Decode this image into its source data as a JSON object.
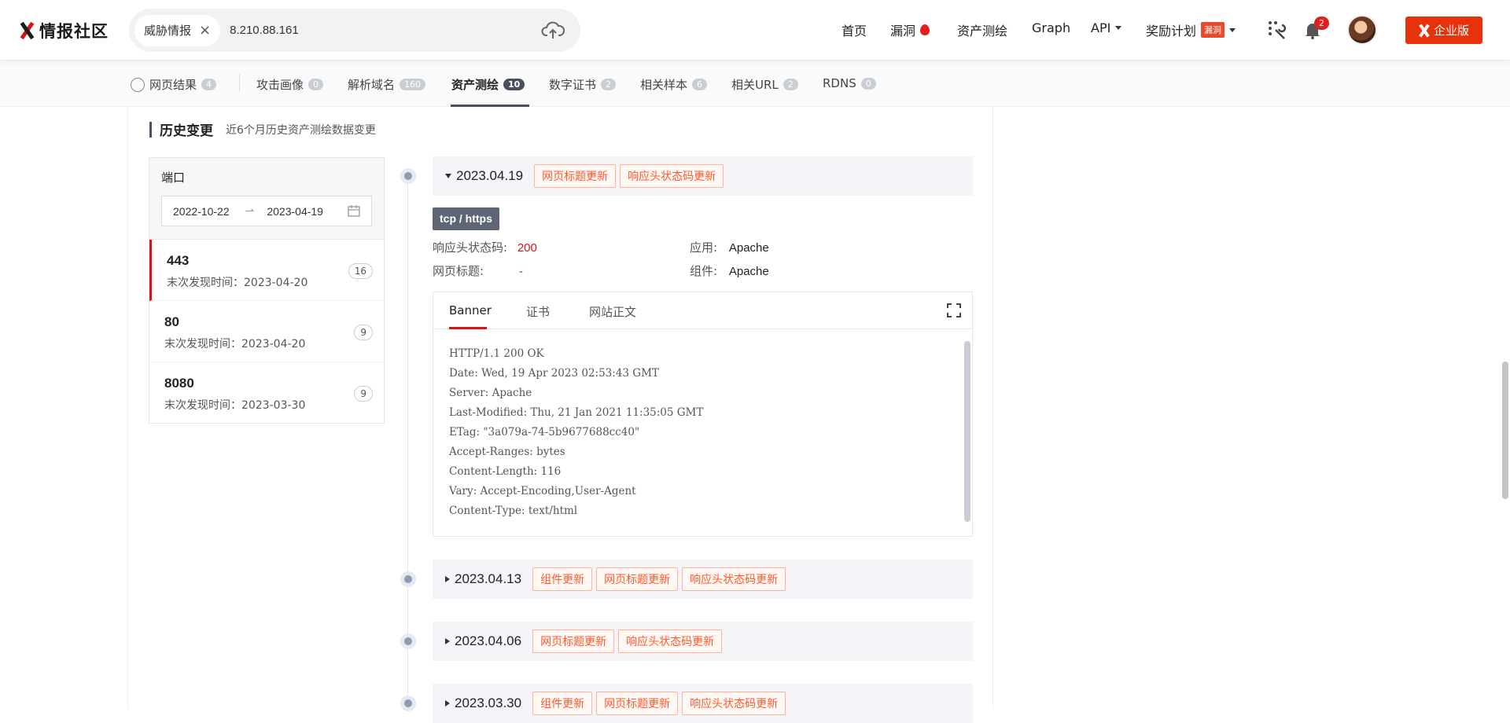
{
  "logo": {
    "name": "情报社区"
  },
  "search": {
    "chip": "威胁情报",
    "query": "8.210.88.161"
  },
  "topnav": {
    "home": "首页",
    "vuln": "漏洞",
    "asset": "资产测绘",
    "graph": "Graph",
    "api": "API",
    "reward": "奖励计划",
    "reward_tag": "漏洞",
    "notif_count": "2",
    "enterprise": "企业版"
  },
  "tabs": [
    {
      "label": "网页结果",
      "count": "4"
    },
    {
      "label": "攻击画像",
      "count": "0"
    },
    {
      "label": "解析域名",
      "count": "160"
    },
    {
      "label": "资产测绘",
      "count": "10"
    },
    {
      "label": "数字证书",
      "count": "2"
    },
    {
      "label": "相关样本",
      "count": "6"
    },
    {
      "label": "相关URL",
      "count": "2"
    },
    {
      "label": "RDNS",
      "count": "0"
    }
  ],
  "history": {
    "title": "历史变更",
    "subtitle": "近6个月历史资产测绘数据变更"
  },
  "portpanel": {
    "label": "端口",
    "date_start": "2022-10-22",
    "date_end": "2023-04-19",
    "ports": [
      {
        "port": "443",
        "seen": "末次发现时间：2023-04-20",
        "count": "16"
      },
      {
        "port": "80",
        "seen": "末次发现时间：2023-04-20",
        "count": "9"
      },
      {
        "port": "8080",
        "seen": "末次发现时间：2023-03-30",
        "count": "9"
      }
    ]
  },
  "entries": [
    {
      "date": "2023.04.19",
      "tags": [
        "网页标题更新",
        "响应头状态码更新"
      ]
    },
    {
      "date": "2023.04.13",
      "tags": [
        "组件更新",
        "网页标题更新",
        "响应头状态码更新"
      ]
    },
    {
      "date": "2023.04.06",
      "tags": [
        "网页标题更新",
        "响应头状态码更新"
      ]
    },
    {
      "date": "2023.03.30",
      "tags": [
        "组件更新",
        "网页标题更新",
        "响应头状态码更新"
      ]
    }
  ],
  "detail": {
    "protocol": "tcp / https",
    "status_label": "响应头状态码:",
    "status_value": "200",
    "title_label": "网页标题:",
    "title_value": "-",
    "app_label": "应用:",
    "app_value": "Apache",
    "comp_label": "组件:",
    "comp_value": "Apache",
    "tabs": [
      "Banner",
      "证书",
      "网站正文"
    ],
    "banner_lines": [
      "HTTP/1.1 200 OK",
      "Date: Wed, 19 Apr 2023 02:53:43 GMT",
      "Server: Apache",
      "Last-Modified: Thu, 21 Jan 2021 11:35:05 GMT",
      "ETag: \"3a079a-74-5b9677688cc40\"",
      "Accept-Ranges: bytes",
      "Content-Length: 116",
      "Vary: Accept-Encoding,User-Agent",
      "Content-Type: text/html"
    ]
  }
}
